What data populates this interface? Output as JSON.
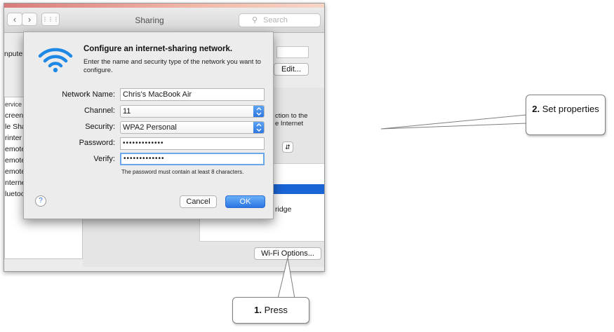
{
  "window": {
    "title": "Sharing",
    "search_placeholder": "Search",
    "nav_back": "‹",
    "nav_forward": "›",
    "grid": "⋮⋮⋮",
    "computer_name_label": "nputer",
    "edit_button": "Edit...",
    "right_text_1": "ction to the",
    "right_text_2": "e Internet",
    "right_text_3": "ridge",
    "wifi_options_button": "Wi-Fi Options...",
    "service_items": [
      "ervice",
      "creen",
      "le Sha",
      "rinter",
      "emote",
      "emote",
      "emote",
      "nternet",
      "luetoo"
    ]
  },
  "sheet": {
    "title": "Configure an internet-sharing network.",
    "description": "Enter the name and security type of the network you want to configure.",
    "fields": {
      "network_name_label": "Network Name:",
      "network_name_value": "Chris's MacBook Air",
      "channel_label": "Channel:",
      "channel_value": "11",
      "security_label": "Security:",
      "security_value": "WPA2 Personal",
      "password_label": "Password:",
      "password_value": "•••••••••••••",
      "verify_label": "Verify:",
      "verify_value": "•••••••••••••"
    },
    "hint": "The password must contain at least 8 characters.",
    "help_button": "?",
    "cancel_button": "Cancel",
    "ok_button": "OK"
  },
  "callouts": {
    "set_properties_step": "2.",
    "set_properties_text": "Set properties",
    "press_step": "1.",
    "press_text": "Press"
  },
  "colors": {
    "accent_blue": "#2c73e1",
    "wifi_icon": "#1e88e5"
  },
  "icons": {
    "wifi": "wifi-icon",
    "search": "search-icon",
    "popup_arrows": "chevron-updown-icon"
  }
}
